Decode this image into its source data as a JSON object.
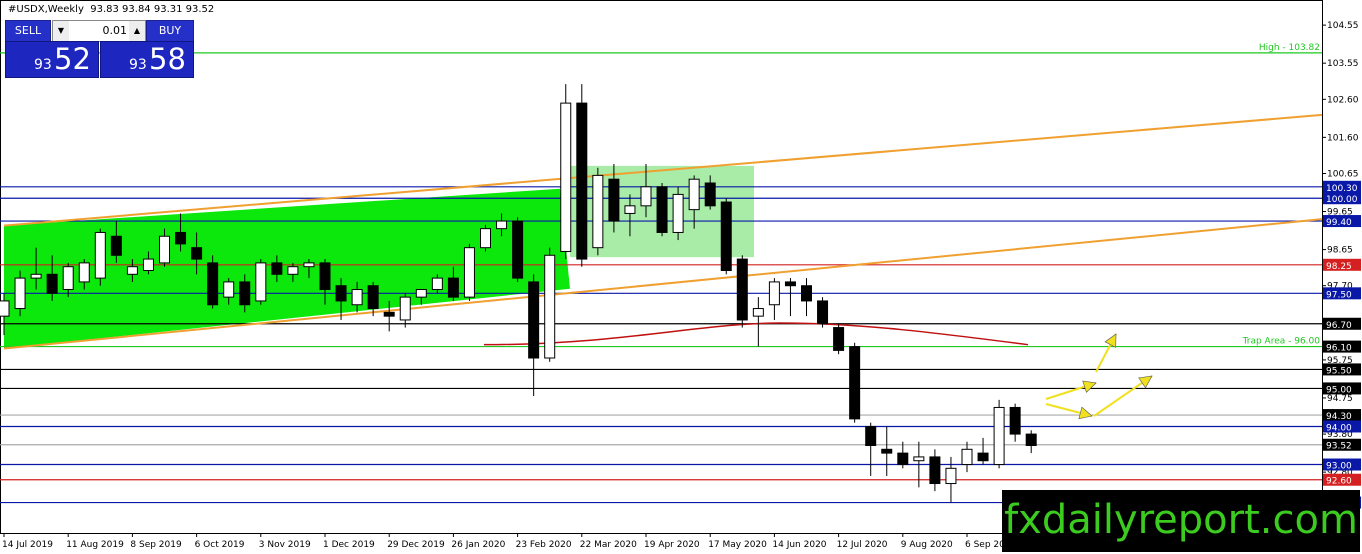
{
  "header": {
    "symbol": "#USDX,Weekly",
    "ohlc": "93.83 93.84 93.31 93.52"
  },
  "trade_panel": {
    "sell_label": "SELL",
    "buy_label": "BUY",
    "lot_value": "0.01",
    "sell_prefix": "93",
    "sell_big": "52",
    "buy_prefix": "93",
    "buy_big": "58"
  },
  "watermark": "fxdailyreport.com",
  "chart_data": {
    "type": "candlestick",
    "ylim": [
      91.2,
      105.0
    ],
    "price_ticks": [
      "104.55",
      "103.55",
      "102.60",
      "101.60",
      "100.65",
      "99.65",
      "98.65",
      "97.70",
      "96.70",
      "95.75",
      "94.75",
      "93.80",
      "92.80",
      "91.85"
    ],
    "x_labels": [
      {
        "i": 0,
        "label": "14 Jul 2019"
      },
      {
        "i": 4,
        "label": "11 Aug 2019"
      },
      {
        "i": 8,
        "label": "8 Sep 2019"
      },
      {
        "i": 12,
        "label": "6 Oct 2019"
      },
      {
        "i": 16,
        "label": "3 Nov 2019"
      },
      {
        "i": 20,
        "label": "1 Dec 2019"
      },
      {
        "i": 24,
        "label": "29 Dec 2019"
      },
      {
        "i": 28,
        "label": "26 Jan 2020"
      },
      {
        "i": 32,
        "label": "23 Feb 2020"
      },
      {
        "i": 36,
        "label": "22 Mar 2020"
      },
      {
        "i": 40,
        "label": "19 Apr 2020"
      },
      {
        "i": 44,
        "label": "17 May 2020"
      },
      {
        "i": 48,
        "label": "14 Jun 2020"
      },
      {
        "i": 52,
        "label": "12 Jul 2020"
      },
      {
        "i": 56,
        "label": "9 Aug 2020"
      },
      {
        "i": 60,
        "label": "6 Sep 2020"
      }
    ],
    "candles": [
      {
        "o": 96.9,
        "h": 97.5,
        "c": 97.3,
        "l": 96.4
      },
      {
        "o": 97.1,
        "h": 98.1,
        "c": 97.9,
        "l": 96.9
      },
      {
        "o": 97.9,
        "h": 98.7,
        "c": 98.0,
        "l": 97.6
      },
      {
        "o": 98.0,
        "h": 98.5,
        "c": 97.5,
        "l": 97.3
      },
      {
        "o": 97.6,
        "h": 98.3,
        "c": 98.2,
        "l": 97.4
      },
      {
        "o": 97.8,
        "h": 98.4,
        "c": 98.3,
        "l": 97.6
      },
      {
        "o": 97.9,
        "h": 99.2,
        "c": 99.1,
        "l": 97.7
      },
      {
        "o": 99.0,
        "h": 99.4,
        "c": 98.5,
        "l": 98.3
      },
      {
        "o": 98.0,
        "h": 98.4,
        "c": 98.2,
        "l": 97.8
      },
      {
        "o": 98.1,
        "h": 98.6,
        "c": 98.4,
        "l": 98.0
      },
      {
        "o": 98.3,
        "h": 99.2,
        "c": 99.0,
        "l": 98.2
      },
      {
        "o": 99.1,
        "h": 99.6,
        "c": 98.8,
        "l": 98.6
      },
      {
        "o": 98.7,
        "h": 99.1,
        "c": 98.4,
        "l": 98.0
      },
      {
        "o": 98.3,
        "h": 98.5,
        "c": 97.2,
        "l": 97.1
      },
      {
        "o": 97.4,
        "h": 97.9,
        "c": 97.8,
        "l": 97.2
      },
      {
        "o": 97.8,
        "h": 98.0,
        "c": 97.2,
        "l": 97.0
      },
      {
        "o": 97.3,
        "h": 98.4,
        "c": 98.3,
        "l": 97.2
      },
      {
        "o": 98.3,
        "h": 98.5,
        "c": 98.0,
        "l": 97.8
      },
      {
        "o": 98.0,
        "h": 98.3,
        "c": 98.2,
        "l": 97.8
      },
      {
        "o": 98.2,
        "h": 98.4,
        "c": 98.3,
        "l": 97.9
      },
      {
        "o": 98.3,
        "h": 98.4,
        "c": 97.6,
        "l": 97.2
      },
      {
        "o": 97.7,
        "h": 97.9,
        "c": 97.3,
        "l": 96.8
      },
      {
        "o": 97.2,
        "h": 97.8,
        "c": 97.6,
        "l": 97.0
      },
      {
        "o": 97.7,
        "h": 97.8,
        "c": 97.1,
        "l": 96.9
      },
      {
        "o": 97.0,
        "h": 97.3,
        "c": 96.9,
        "l": 96.5
      },
      {
        "o": 96.8,
        "h": 97.5,
        "c": 97.4,
        "l": 96.6
      },
      {
        "o": 97.4,
        "h": 97.6,
        "c": 97.6,
        "l": 97.2
      },
      {
        "o": 97.6,
        "h": 98.0,
        "c": 97.9,
        "l": 97.5
      },
      {
        "o": 97.9,
        "h": 98.2,
        "c": 97.4,
        "l": 97.3
      },
      {
        "o": 97.4,
        "h": 98.8,
        "c": 98.7,
        "l": 97.3
      },
      {
        "o": 98.7,
        "h": 99.3,
        "c": 99.2,
        "l": 98.6
      },
      {
        "o": 99.2,
        "h": 99.6,
        "c": 99.4,
        "l": 99.0
      },
      {
        "o": 99.4,
        "h": 99.5,
        "c": 97.9,
        "l": 97.8
      },
      {
        "o": 97.8,
        "h": 98.0,
        "c": 95.8,
        "l": 94.8
      },
      {
        "o": 95.8,
        "h": 98.7,
        "c": 98.5,
        "l": 95.7
      },
      {
        "o": 98.6,
        "h": 103.0,
        "c": 102.5,
        "l": 98.4
      },
      {
        "o": 102.5,
        "h": 103.0,
        "c": 98.4,
        "l": 98.2
      },
      {
        "o": 98.7,
        "h": 100.8,
        "c": 100.6,
        "l": 98.5
      },
      {
        "o": 100.5,
        "h": 100.9,
        "c": 99.4,
        "l": 99.1
      },
      {
        "o": 99.6,
        "h": 100.1,
        "c": 99.8,
        "l": 99.0
      },
      {
        "o": 99.8,
        "h": 100.9,
        "c": 100.3,
        "l": 99.5
      },
      {
        "o": 100.3,
        "h": 100.4,
        "c": 99.1,
        "l": 99.0
      },
      {
        "o": 99.1,
        "h": 100.3,
        "c": 100.1,
        "l": 98.9
      },
      {
        "o": 99.7,
        "h": 100.6,
        "c": 100.5,
        "l": 99.2
      },
      {
        "o": 100.4,
        "h": 100.6,
        "c": 99.8,
        "l": 99.7
      },
      {
        "o": 99.9,
        "h": 100.0,
        "c": 98.1,
        "l": 98.0
      },
      {
        "o": 98.4,
        "h": 98.5,
        "c": 96.8,
        "l": 96.6
      },
      {
        "o": 96.9,
        "h": 97.4,
        "c": 97.1,
        "l": 96.1
      },
      {
        "o": 97.2,
        "h": 97.9,
        "c": 97.8,
        "l": 96.8
      },
      {
        "o": 97.8,
        "h": 97.9,
        "c": 97.7,
        "l": 96.9
      },
      {
        "o": 97.7,
        "h": 97.9,
        "c": 97.3,
        "l": 96.9
      },
      {
        "o": 97.3,
        "h": 97.4,
        "c": 96.7,
        "l": 96.6
      },
      {
        "o": 96.6,
        "h": 96.7,
        "c": 96.0,
        "l": 95.9
      },
      {
        "o": 96.1,
        "h": 96.2,
        "c": 94.2,
        "l": 94.1
      },
      {
        "o": 94.0,
        "h": 94.1,
        "c": 93.5,
        "l": 92.7
      },
      {
        "o": 93.4,
        "h": 94.0,
        "c": 93.3,
        "l": 92.7
      },
      {
        "o": 93.3,
        "h": 93.6,
        "c": 93.0,
        "l": 92.9
      },
      {
        "o": 93.1,
        "h": 93.6,
        "c": 93.2,
        "l": 92.4
      },
      {
        "o": 93.2,
        "h": 93.4,
        "c": 92.5,
        "l": 92.3
      },
      {
        "o": 92.5,
        "h": 93.2,
        "c": 92.9,
        "l": 92.0
      },
      {
        "o": 93.0,
        "h": 93.6,
        "c": 93.4,
        "l": 92.8
      },
      {
        "o": 93.3,
        "h": 93.7,
        "c": 93.1,
        "l": 93.0
      },
      {
        "o": 93.0,
        "h": 94.7,
        "c": 94.5,
        "l": 92.9
      },
      {
        "o": 94.5,
        "h": 94.6,
        "c": 93.8,
        "l": 93.6
      },
      {
        "o": 93.8,
        "h": 93.9,
        "c": 93.5,
        "l": 93.3
      }
    ],
    "hlines": [
      {
        "price": 103.82,
        "color": "#1fc81f",
        "label": "High - 103.82"
      },
      {
        "price": 100.3,
        "color": "#0a18a8",
        "tag": "100.30",
        "tagbg": "#0a18a8"
      },
      {
        "price": 100.0,
        "color": "#0a18a8",
        "tag": "100.00",
        "tagbg": "#0a18a8"
      },
      {
        "price": 99.4,
        "color": "#0a18a8",
        "tag": "99.40",
        "tagbg": "#0a18a8"
      },
      {
        "price": 98.25,
        "color": "#d42020",
        "tag": "98.25",
        "tagbg": "#d42020"
      },
      {
        "price": 97.5,
        "color": "#0a18a8",
        "tag": "97.50",
        "tagbg": "#0a18a8"
      },
      {
        "price": 96.7,
        "color": "#000000",
        "tag": "96.70",
        "tagbg": "#000000"
      },
      {
        "price": 96.1,
        "color": "#1fc81f",
        "label": "Trap Area - 96.00",
        "tag": "96.10",
        "tagbg": "#000000"
      },
      {
        "price": 95.5,
        "color": "#000000",
        "tag": "95.50",
        "tagbg": "#000000"
      },
      {
        "price": 95.0,
        "color": "#000000",
        "tag": "95.00",
        "tagbg": "#000000"
      },
      {
        "price": 94.3,
        "color": "#aaaaaa",
        "tag": "94.30",
        "tagbg": "#000000"
      },
      {
        "price": 94.0,
        "color": "#0a18a8",
        "tag": "94.00",
        "tagbg": "#0a18a8"
      },
      {
        "price": 93.52,
        "color": "#aaaaaa",
        "tag": "93.52",
        "tagbg": "#000000"
      },
      {
        "price": 93.0,
        "color": "#0a18a8",
        "tag": "93.00",
        "tagbg": "#0a18a8"
      },
      {
        "price": 92.6,
        "color": "#d42020",
        "tag": "92.60",
        "tagbg": "#d42020"
      },
      {
        "price": 92.0,
        "color": "#0a18a8",
        "tag": "92.00",
        "tagbg": "#0a18a8"
      }
    ],
    "colors": {
      "channel_fill": "#0ce80c",
      "box_fill": "#a8eca8",
      "trend": "#f0a030",
      "ma": "#c01010",
      "arrow": "#f0e020"
    }
  }
}
